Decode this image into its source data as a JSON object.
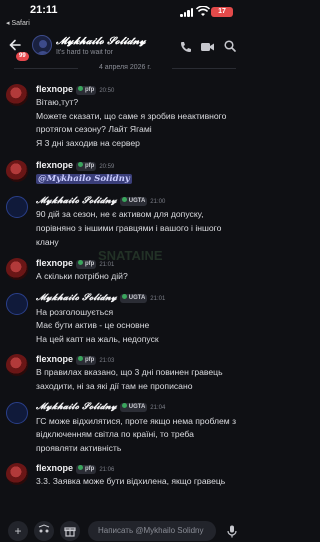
{
  "status_bar": {
    "time": "21:11",
    "back_app": "◂ Safari",
    "battery": "17"
  },
  "header": {
    "unread_count": "99",
    "channel_title": "𝓜𝔂𝓴𝓱𝓪𝓲𝓵𝓸 𝓢𝓸𝓵𝓲𝓭𝓷𝔂",
    "channel_subtitle": "It's hard to wait for",
    "icons": [
      "back-arrow-icon",
      "call-icon",
      "video-icon",
      "search-icon"
    ]
  },
  "date_separator": "4 апреля 2026 г.",
  "messages": [
    {
      "user": "flexnope",
      "tag": "pfp",
      "time": "20:50",
      "lines": [
        "Вітаю,тут?",
        "Можете сказати, що саме я зробив неактивного",
        "протягом сезону? Лайт Ягамі",
        "Я 3 дні заходив на сервер"
      ]
    },
    {
      "user": "flexnope",
      "tag": "pfp",
      "time": "20:59",
      "mention": "@Mykhailo Solidny"
    },
    {
      "user": "𝓜𝔂𝓴𝓱𝓪𝓲𝓵𝓸 𝓢𝓸𝓵𝓲𝓭𝓷𝔂",
      "tag": "UGTA",
      "time": "21:00",
      "lines": [
        "90 дій за сезон, не є активом для допуску,",
        "порівняно з іншими гравцями і вашого і іншого",
        "клану"
      ]
    },
    {
      "user": "flexnope",
      "tag": "pfp",
      "time": "21:01",
      "lines": [
        "А скільки потрібно дій?"
      ]
    },
    {
      "user": "𝓜𝔂𝓴𝓱𝓪𝓲𝓵𝓸 𝓢𝓸𝓵𝓲𝓭𝓷𝔂",
      "tag": "UGTA",
      "time": "21:01",
      "lines": [
        "На розголошується",
        "Має бути актив - це основне",
        "На цей капт на жаль, недопуск"
      ]
    },
    {
      "user": "flexnope",
      "tag": "pfp",
      "time": "21:03",
      "lines": [
        "В правилах вказано, що 3 дні повинен гравець",
        "заходити, ні за які дії там не прописано"
      ]
    },
    {
      "user": "𝓜𝔂𝓴𝓱𝓪𝓲𝓵𝓸 𝓢𝓸𝓵𝓲𝓭𝓷𝔂",
      "tag": "UGTA",
      "time": "21:04",
      "lines": [
        "ГС може відхилятися, проте якщо нема проблем з",
        "відключенням світла по країні, то треба",
        "проявляти активність"
      ]
    },
    {
      "user": "flexnope",
      "tag": "pfp",
      "time": "21:06",
      "lines": [
        "3.3. Заявка може бути відхилена, якщо гравець"
      ]
    }
  ],
  "composer": {
    "placeholder": "Написать @Mykhailo Solidny"
  },
  "watermark": "SNATAINE"
}
